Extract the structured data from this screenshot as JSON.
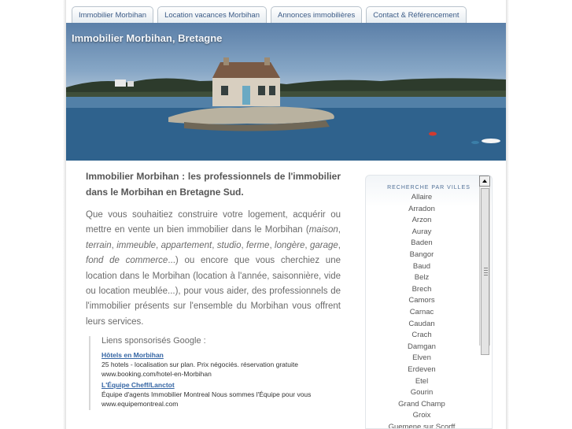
{
  "tabs": [
    {
      "label": "Immobilier Morbihan"
    },
    {
      "label": "Location vacances Morbihan"
    },
    {
      "label": "Annonces immobilières"
    },
    {
      "label": "Contact & Référencement"
    }
  ],
  "banner": {
    "title": "Immobilier Morbihan, Bretagne"
  },
  "main": {
    "intro": "Immobilier Morbihan : les professionnels de l'immobilier dans le Morbihan en Bretagne Sud.",
    "paragraph": {
      "part1": "Que vous souhaitiez construire votre logement, acquérir ou mettre en vente un bien immobilier dans le Morbihan (",
      "maison": "maison",
      "terrain": "terrain",
      "immeuble": "immeuble",
      "appartement": "appartement",
      "studio": "studio",
      "ferme": "ferme",
      "longere": "longère",
      "garage": "garage",
      "fonds": "fond de commerce",
      "part2": "...) ou encore que vous cherchiez une location dans le Morbihan (location à l'année, saisonnière, vide ou location meublée...), pour vous aider, des professionnels de l'immobilier présents sur l'ensemble du Morbihan vous offrent leurs services."
    }
  },
  "sponsored": {
    "label": "Liens sponsorisés Google :",
    "ads": [
      {
        "title": "Hôtels en Morbihan",
        "text": "25 hotels - localisation sur plan. Prix négociés. réservation gratuite",
        "url": "www.booking.com/hotel-en-Morbihan"
      },
      {
        "title": "L'Équipe Cheff/Lanctot",
        "text": "Équipe d'agents Immobilier Montreal Nous sommes l'Équipe pour vous",
        "url": "www.equipemontreal.com"
      }
    ]
  },
  "sidebar": {
    "title": "RECHERCHE PAR VILLES",
    "towns": [
      "Allaire",
      "Arradon",
      "Arzon",
      "Auray",
      "Baden",
      "Bangor",
      "Baud",
      "Belz",
      "Brech",
      "Camors",
      "Carnac",
      "Caudan",
      "Crach",
      "Damgan",
      "Elven",
      "Erdeven",
      "Etel",
      "Gourin",
      "Grand Champ",
      "Groix",
      "Guemene sur Scorff"
    ]
  },
  "colors": {
    "tab_text": "#3b5b86",
    "link": "#3465a4",
    "body_text": "#6a6a6a",
    "sidebar_title": "#4f6f96"
  },
  "icons": {
    "scroll_up": "triangle-up-icon",
    "scroll_grip": "grip-icon"
  }
}
